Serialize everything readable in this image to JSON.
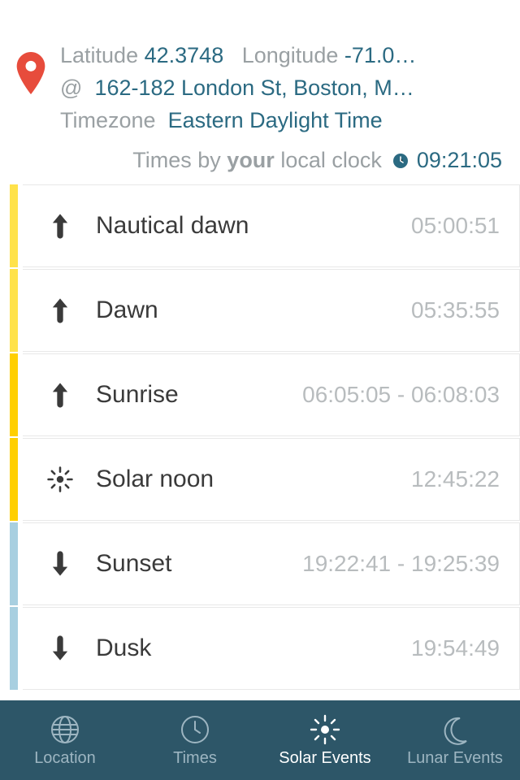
{
  "header": {
    "lat_label": "Latitude",
    "lat_value": "42.3748",
    "lon_label": "Longitude",
    "lon_value": "-71.0…",
    "at": "@",
    "address": "162-182 London St, Boston, M…",
    "tz_label": "Timezone",
    "tz_value": "Eastern Daylight Time"
  },
  "times_by": {
    "prefix": "Times by ",
    "your": "your",
    "suffix": " local clock",
    "time": "09:21:05"
  },
  "events": [
    {
      "icon": "arrow-up",
      "color": "yellow-light",
      "name": "Nautical dawn",
      "time": "05:00:51"
    },
    {
      "icon": "arrow-up",
      "color": "yellow-light",
      "name": "Dawn",
      "time": "05:35:55"
    },
    {
      "icon": "arrow-up",
      "color": "yellow-strong",
      "name": "Sunrise",
      "time": "06:05:05  -  06:08:03"
    },
    {
      "icon": "sun",
      "color": "yellow-strong",
      "name": "Solar noon",
      "time": "12:45:22"
    },
    {
      "icon": "arrow-down",
      "color": "blue-light",
      "name": "Sunset",
      "time": "19:22:41  -  19:25:39"
    },
    {
      "icon": "arrow-down",
      "color": "blue-light",
      "name": "Dusk",
      "time": "19:54:49"
    }
  ],
  "tabs": {
    "location": "Location",
    "times": "Times",
    "solar": "Solar Events",
    "lunar": "Lunar Events"
  }
}
